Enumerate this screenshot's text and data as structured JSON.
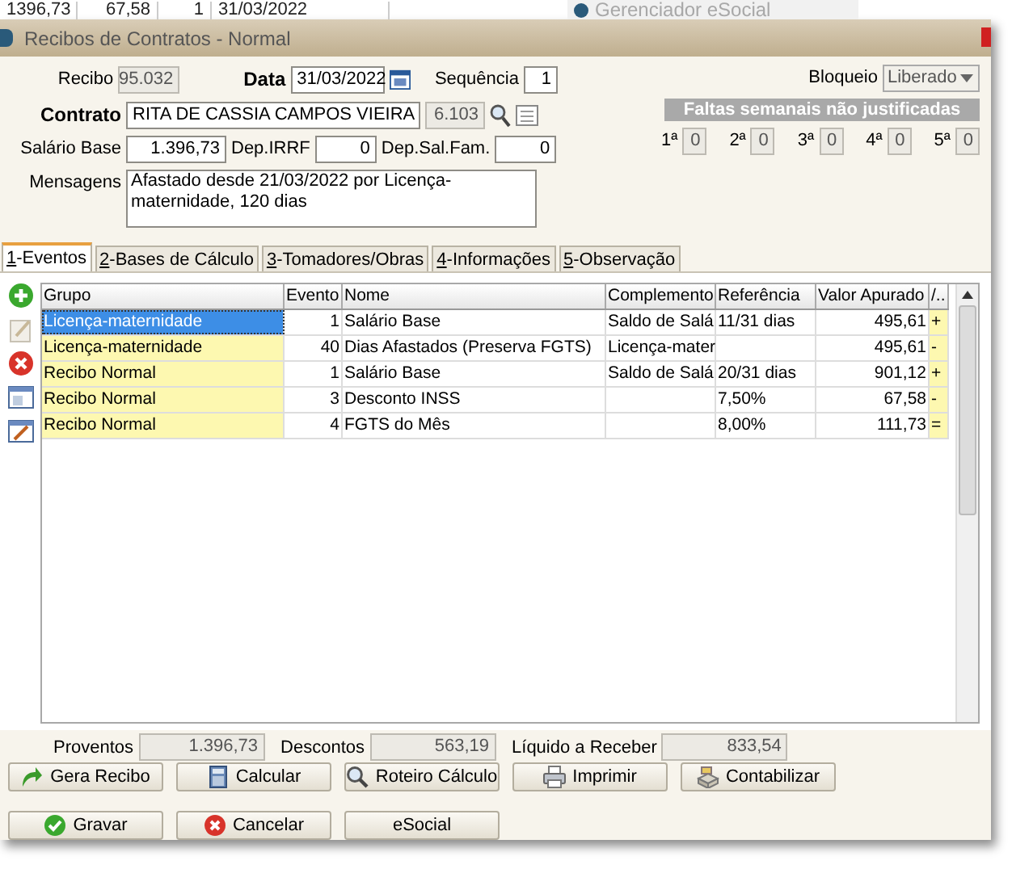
{
  "background_row": {
    "cells": [
      "1396,73",
      "67,58",
      "1",
      "31/03/2022"
    ],
    "app_label": "Gerenciador eSocial"
  },
  "window": {
    "title": "Recibos de Contratos - Normal"
  },
  "form": {
    "recibo_label": "Recibo",
    "recibo": "95.032",
    "data_label": "Data",
    "data": "31/03/2022",
    "sequencia_label": "Sequência",
    "sequencia": "1",
    "bloqueio_label": "Bloqueio",
    "bloqueio": "Liberado",
    "contrato_label": "Contrato",
    "contrato": "RITA DE CASSIA CAMPOS VIEIRA",
    "contrato_codigo": "6.103",
    "salario_label": "Salário Base",
    "salario": "1.396,73",
    "dep_irrf_label": "Dep.IRRF",
    "dep_irrf": "0",
    "dep_salfam_label": "Dep.Sal.Fam.",
    "dep_salfam": "0",
    "mensagens_label": "Mensagens",
    "mensagens": "Afastado desde 21/03/2022 por Licença-maternidade, 120 dias"
  },
  "faltas": {
    "title": "Faltas semanais não justificadas",
    "weeks": [
      {
        "label": "1ª",
        "value": "0"
      },
      {
        "label": "2ª",
        "value": "0"
      },
      {
        "label": "3ª",
        "value": "0"
      },
      {
        "label": "4ª",
        "value": "0"
      },
      {
        "label": "5ª",
        "value": "0"
      }
    ]
  },
  "tabs": [
    {
      "label": "1-Eventos",
      "selected": true
    },
    {
      "label": "2-Bases de Cálculo",
      "selected": false
    },
    {
      "label": "3-Tomadores/Obras",
      "selected": false
    },
    {
      "label": "4-Informações",
      "selected": false
    },
    {
      "label": "5-Observação",
      "selected": false
    }
  ],
  "table": {
    "columns": [
      "Grupo",
      "Evento",
      "Nome",
      "Complemento",
      "Referência",
      "Valor Apurado",
      "/.."
    ],
    "rows": [
      {
        "cells": [
          "Licença-maternidade",
          "1",
          "Salário Base",
          "Saldo de Salá",
          "11/31 dias",
          "495,61",
          "+"
        ],
        "selected": true
      },
      {
        "cells": [
          "Licença-maternidade",
          "40",
          "Dias Afastados (Preserva FGTS)",
          "Licença-mater",
          "",
          "495,61",
          "-"
        ],
        "selected": false
      },
      {
        "cells": [
          "Recibo Normal",
          "1",
          "Salário Base",
          "Saldo de Salá",
          "20/31 dias",
          "901,12",
          "+"
        ],
        "selected": false
      },
      {
        "cells": [
          "Recibo Normal",
          "3",
          "Desconto INSS",
          "",
          "7,50%",
          "67,58",
          "-"
        ],
        "selected": false
      },
      {
        "cells": [
          "Recibo Normal",
          "4",
          "FGTS do Mês",
          "",
          "8,00%",
          "111,73",
          "="
        ],
        "selected": false
      }
    ]
  },
  "totals": [
    {
      "label": "Proventos",
      "value": "1.396,73"
    },
    {
      "label": "Descontos",
      "value": "563,19"
    },
    {
      "label": "Líquido a Receber",
      "value": "833,54"
    }
  ],
  "actions": [
    {
      "label": "Gera Recibo",
      "kind": "arrow"
    },
    {
      "label": "Calcular",
      "kind": "calculator"
    },
    {
      "label": "Roteiro Cálculo",
      "kind": "search"
    },
    {
      "label": "Imprimir",
      "kind": "printer"
    },
    {
      "label": "Contabilizar",
      "kind": "register"
    }
  ],
  "footer_buttons": [
    {
      "label": "Gravar",
      "kind": "ok"
    },
    {
      "label": "Cancelar",
      "kind": "cancel"
    },
    {
      "label": "eSocial",
      "kind": "none"
    }
  ]
}
